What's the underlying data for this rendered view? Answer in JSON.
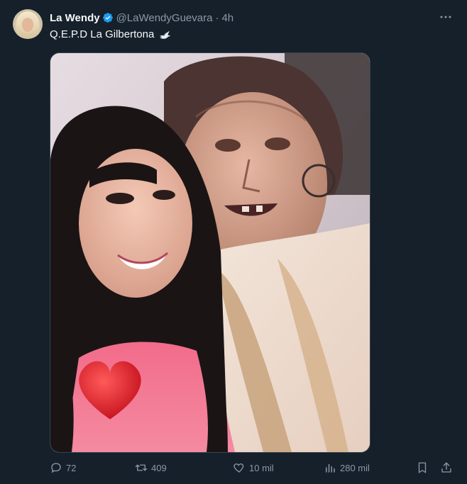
{
  "tweet": {
    "author_name": "La Wendy",
    "handle": "@LaWendyGuevara",
    "separator": "·",
    "time": "4h",
    "text": "Q.E.P.D La Gilbertona",
    "emoji_icon": "dove-icon",
    "verified_color": "#1d9bf0"
  },
  "actions": {
    "replies": "72",
    "retweets": "409",
    "likes": "10 mil",
    "views": "280 mil"
  },
  "colors": {
    "background": "#15202b",
    "muted": "#8b98a5",
    "text": "#f7f9f9"
  }
}
